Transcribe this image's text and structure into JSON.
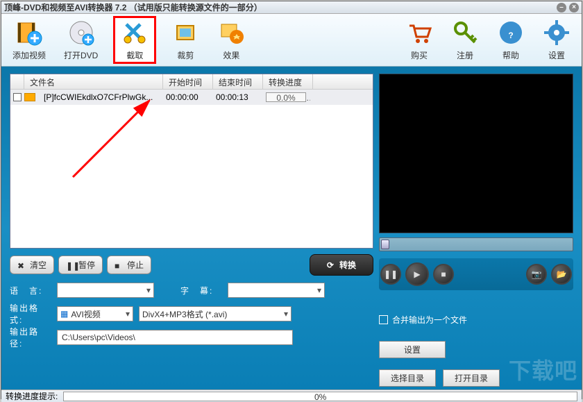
{
  "title": "顶峰-DVD和视频至AVI转换器 7.2 （试用版只能转换源文件的一部分）",
  "toolbar": {
    "left": [
      {
        "name": "add-video",
        "label": "添加视频"
      },
      {
        "name": "open-dvd",
        "label": "打开DVD"
      },
      {
        "name": "capture",
        "label": "截取"
      },
      {
        "name": "crop",
        "label": "裁剪"
      },
      {
        "name": "effect",
        "label": "效果"
      }
    ],
    "right": [
      {
        "name": "buy",
        "label": "购买"
      },
      {
        "name": "register",
        "label": "注册"
      },
      {
        "name": "help",
        "label": "帮助"
      },
      {
        "name": "settings",
        "label": "设置"
      }
    ]
  },
  "table": {
    "headers": {
      "name": "文件名",
      "start": "开始时间",
      "end": "结束时间",
      "prog": "转换进度"
    },
    "row": {
      "name": "[P]fcCWIEkdlxO7CFrPlwGk...",
      "start": "00:00:00",
      "end": "00:00:13",
      "prog": "0.0%"
    }
  },
  "controls": {
    "clear": "清空",
    "pause": "暂停",
    "stop": "停止",
    "convert": "转换"
  },
  "form": {
    "lang_label": "语　言:",
    "subtitle_label": "字　幕:",
    "fmt_label": "输出格式:",
    "fmt_type": "AVI视频",
    "fmt_detail": "DivX4+MP3格式 (*.avi)",
    "fmt_set": "设置",
    "path_label": "输出路径:",
    "path_value": "C:\\Users\\pc\\Videos\\",
    "browse": "选择目录",
    "open": "打开目录"
  },
  "merge_label": "合并输出为一个文件",
  "status": {
    "label": "转换进度提示:",
    "pct": "0%"
  },
  "watermark": "下载吧"
}
